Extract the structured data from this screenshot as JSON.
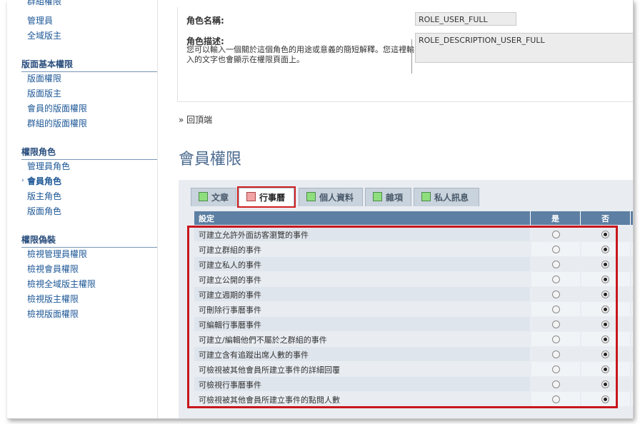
{
  "sidebar": {
    "top_items": [
      "群組權限",
      "管理員",
      "全域版主"
    ],
    "sections": [
      {
        "title": "版面基本權限",
        "items": [
          "版面權限",
          "版面版主",
          "會員的版面權限",
          "群組的版面權限"
        ]
      },
      {
        "title": "權限角色",
        "items": [
          "管理員角色",
          "會員角色",
          "版主角色",
          "版面角色"
        ],
        "active_index": 1
      },
      {
        "title": "權限偽裝",
        "items": [
          "檢視管理員權限",
          "檢視會員權限",
          "檢視全域版主權限",
          "檢視版主權限",
          "檢視版面權限"
        ]
      }
    ]
  },
  "role": {
    "name_label": "角色名稱:",
    "name_value": "ROLE_USER_FULL",
    "desc_label": "角色描述:",
    "desc_help": "您可以輸入一個關於這個角色的用途或意義的簡短解釋。您這裡輸入的文字也會顯示在權限頁面上。",
    "desc_value": "ROLE_DESCRIPTION_USER_FULL"
  },
  "back_to_top": "回頂端",
  "back_marker": "»",
  "page_title": "會員權限",
  "tabs": [
    {
      "label": "文章",
      "color": "green"
    },
    {
      "label": "行事曆",
      "color": "pink",
      "active": true
    },
    {
      "label": "個人資料",
      "color": "green"
    },
    {
      "label": "雜項",
      "color": "green"
    },
    {
      "label": "私人訊息",
      "color": "green"
    }
  ],
  "table": {
    "headers": [
      "設定",
      "是",
      "否"
    ],
    "rows": [
      {
        "label": "可建立允許外面訪客瀏覽的事件",
        "value": "no"
      },
      {
        "label": "可建立群組的事件",
        "value": "no"
      },
      {
        "label": "可建立私人的事件",
        "value": "no"
      },
      {
        "label": "可建立公開的事件",
        "value": "no"
      },
      {
        "label": "可建立週期的事件",
        "value": "no"
      },
      {
        "label": "可刪除行事曆事件",
        "value": "no"
      },
      {
        "label": "可編輯行事曆事件",
        "value": "no"
      },
      {
        "label": "可建立/編輯他們不屬於之群組的事件",
        "value": "no"
      },
      {
        "label": "可建立含有追蹤出席人數的事件",
        "value": "no"
      },
      {
        "label": "可檢視被其他會員所建立事件的詳細回覆",
        "value": "no"
      },
      {
        "label": "可檢視行事曆事件",
        "value": "no"
      },
      {
        "label": "可檢視被其他會員所建立事件的點閱人數",
        "value": "no"
      }
    ]
  },
  "colors": {
    "link": "#1d5796",
    "header_bg": "#5d7fa3",
    "highlight": "#c8161d",
    "title": "#4a6a8f"
  }
}
